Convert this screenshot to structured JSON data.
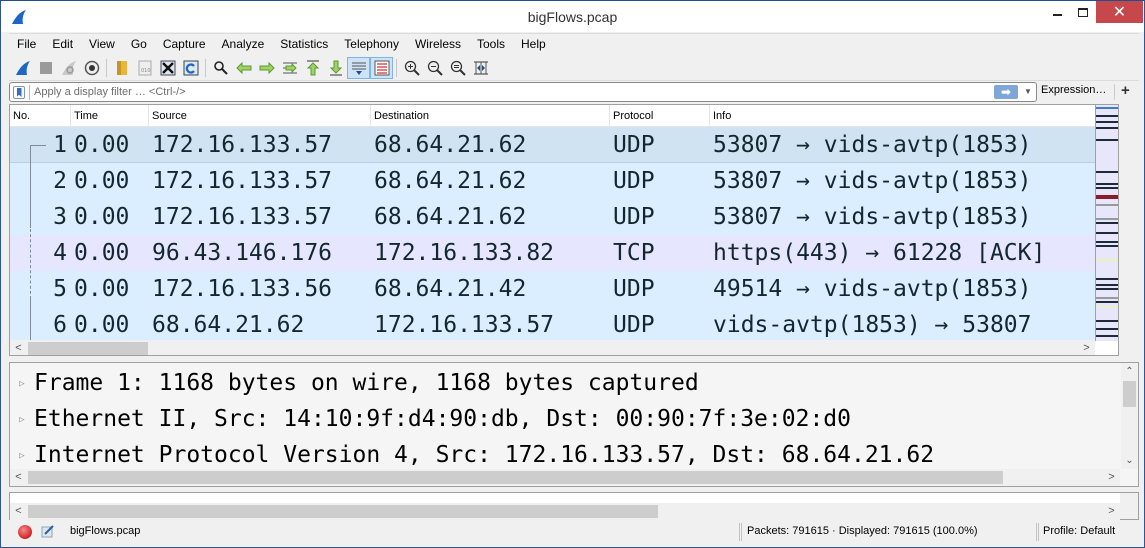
{
  "window": {
    "title": "bigFlows.pcap",
    "controls": {
      "minimize": "–",
      "maximize": "□",
      "close": "✕"
    }
  },
  "menu": [
    "File",
    "Edit",
    "View",
    "Go",
    "Capture",
    "Analyze",
    "Statistics",
    "Telephony",
    "Wireless",
    "Tools",
    "Help"
  ],
  "toolbar": {
    "buttons": [
      {
        "icon": "shark-fin-start-capture-icon"
      },
      {
        "icon": "stop-capture-icon"
      },
      {
        "icon": "restart-capture-icon"
      },
      {
        "icon": "capture-options-icon"
      },
      {
        "icon": "open-file-icon"
      },
      {
        "icon": "save-file-icon"
      },
      {
        "icon": "close-file-icon"
      },
      {
        "icon": "reload-file-icon"
      },
      {
        "icon": "find-packet-icon"
      },
      {
        "icon": "go-back-icon"
      },
      {
        "icon": "go-forward-icon"
      },
      {
        "icon": "go-to-packet-icon"
      },
      {
        "icon": "go-first-packet-icon"
      },
      {
        "icon": "go-last-packet-icon"
      },
      {
        "icon": "auto-scroll-icon",
        "active": true
      },
      {
        "icon": "colorize-icon",
        "active": true
      },
      {
        "icon": "zoom-in-icon"
      },
      {
        "icon": "zoom-out-icon"
      },
      {
        "icon": "normal-size-icon"
      },
      {
        "icon": "resize-columns-icon"
      }
    ]
  },
  "filter": {
    "placeholder": "Apply a display filter … <Ctrl-/>",
    "value": "",
    "apply_icon": "➡",
    "dropdown_icon": "▼",
    "expression_label": "Expression…",
    "add_label": "+"
  },
  "packet_list": {
    "columns": [
      "No.",
      "Time",
      "Source",
      "Destination",
      "Protocol",
      "Info"
    ],
    "rows": [
      {
        "no": "1",
        "time": "0.00",
        "source": "172.16.133.57",
        "destination": "68.64.21.62",
        "protocol": "UDP",
        "info": "53807 → vids-avtp(1853)",
        "selected": true
      },
      {
        "no": "2",
        "time": "0.00",
        "source": "172.16.133.57",
        "destination": "68.64.21.62",
        "protocol": "UDP",
        "info": "53807 → vids-avtp(1853)"
      },
      {
        "no": "3",
        "time": "0.00",
        "source": "172.16.133.57",
        "destination": "68.64.21.62",
        "protocol": "UDP",
        "info": "53807 → vids-avtp(1853)"
      },
      {
        "no": "4",
        "time": "0.00",
        "source": "96.43.146.176",
        "destination": "172.16.133.82",
        "protocol": "TCP",
        "info": "https(443) → 61228 [ACK]"
      },
      {
        "no": "5",
        "time": "0.00",
        "source": "172.16.133.56",
        "destination": "68.64.21.42",
        "protocol": "UDP",
        "info": "49514 → vids-avtp(1853)"
      },
      {
        "no": "6",
        "time": "0.00",
        "source": "68.64.21.62",
        "destination": "172.16.133.57",
        "protocol": "UDP",
        "info": "vids-avtp(1853) → 53807"
      }
    ]
  },
  "details": {
    "rows": [
      "Frame 1: 1168 bytes on wire, 1168 bytes captured",
      "Ethernet II, Src: 14:10:9f:d4:90:db, Dst: 00:90:7f:3e:02:d0",
      "Internet Protocol Version 4, Src: 172.16.133.57, Dst: 68.64.21.62"
    ],
    "expand_icon": "▷"
  },
  "scroll": {
    "left": "<",
    "right": ">",
    "up": "^",
    "down": "v"
  },
  "status": {
    "file": "bigFlows.pcap",
    "packets": "Packets: 791615 · Displayed: 791615 (100.0%)",
    "profile": "Profile: Default"
  },
  "colors": {
    "udp_row": "#daeeff",
    "tcp_row": "#e7e6ff",
    "selected_row": "#cfe3f3",
    "close_button": "#c7484a",
    "accent": "#2b579a"
  }
}
